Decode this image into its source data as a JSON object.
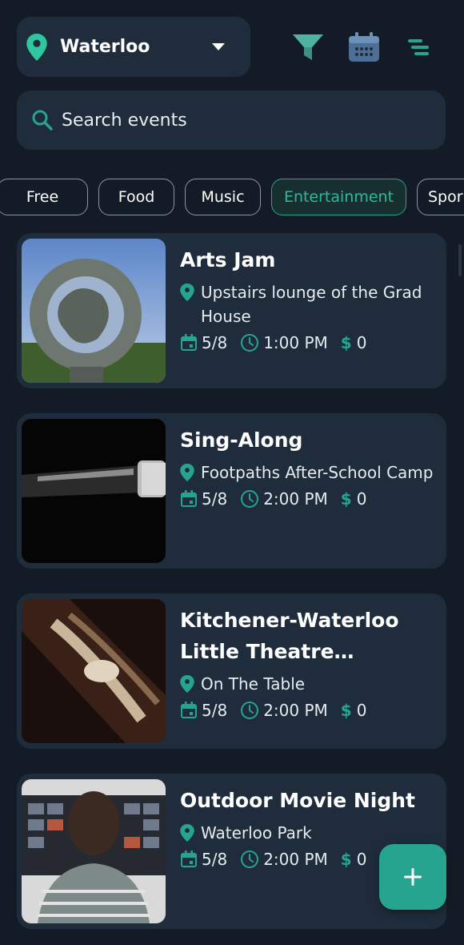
{
  "colors": {
    "background": "#131c26",
    "card": "#1f2c3b",
    "accent": "#27a48f"
  },
  "header": {
    "location": "Waterloo",
    "icons": [
      "location-pin-icon",
      "chevron-down-icon",
      "filter-icon",
      "calendar-icon",
      "sort-icon"
    ]
  },
  "search": {
    "placeholder": "Search events"
  },
  "categories": {
    "chips": [
      {
        "label": "Free",
        "active": false
      },
      {
        "label": "Food",
        "active": false
      },
      {
        "label": "Music",
        "active": false
      },
      {
        "label": "Entertainment",
        "active": true
      },
      {
        "label": "Spor",
        "active": false
      }
    ]
  },
  "events": [
    {
      "title": "Arts Jam",
      "venue": "Upstairs lounge of the Grad House",
      "date": "5/8",
      "time": "1:00 PM",
      "price": "0"
    },
    {
      "title": "Sing-Along",
      "venue": "Footpaths After-School Camp",
      "date": "5/8",
      "time": "2:00 PM",
      "price": "0"
    },
    {
      "title": "Kitchener-Waterloo Little Theatre Presents: On The Table",
      "venue": "On The Table",
      "date": "5/8",
      "time": "2:00 PM",
      "price": "0"
    },
    {
      "title": "Outdoor Movie Night",
      "venue": "Waterloo Park",
      "date": "5/8",
      "time": "2:00 PM",
      "price": "0"
    }
  ],
  "fab": {
    "label": "+"
  }
}
